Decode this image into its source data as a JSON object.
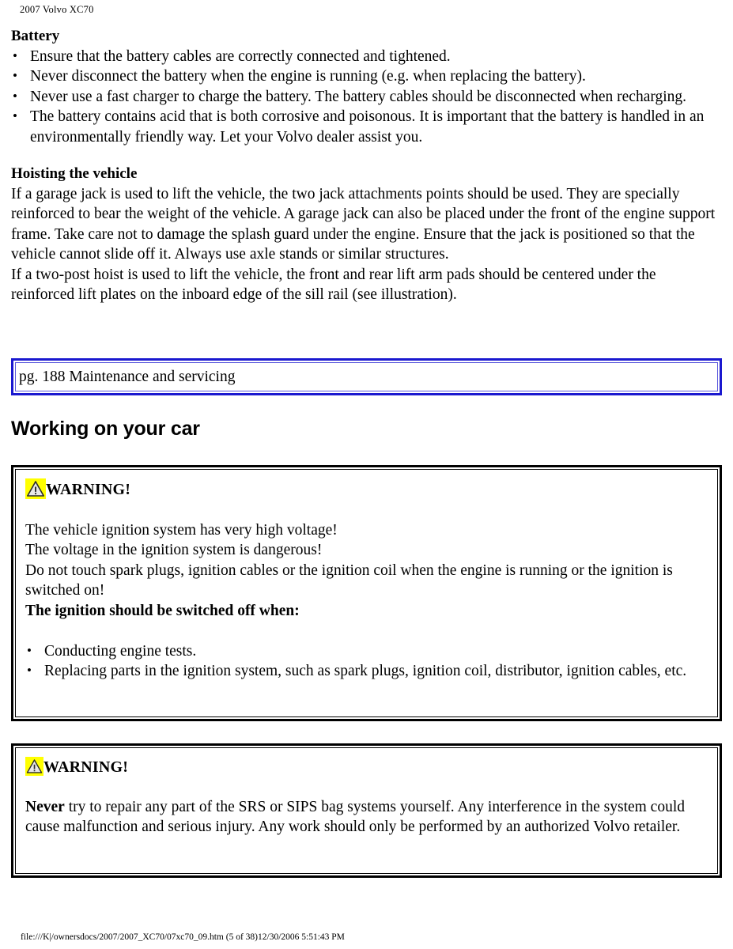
{
  "header": {
    "running_title": "2007 Volvo XC70"
  },
  "sections": {
    "battery": {
      "title": "Battery",
      "bullets": [
        "Ensure that the battery cables are correctly connected and tightened.",
        "Never disconnect the battery when the engine is running (e.g. when replacing the battery).",
        "Never use a fast charger to charge the battery. The battery cables should be disconnected when recharging.",
        "The battery contains acid that is both corrosive and poisonous. It is important that the battery is handled in an environmentally friendly way. Let your Volvo dealer assist you."
      ]
    },
    "hoisting": {
      "title": "Hoisting the vehicle",
      "paragraphs": [
        "If a garage jack is used to lift the vehicle, the two jack attachments points should be used. They are specially reinforced to bear the weight of the vehicle. A garage jack can also be placed under the front of the engine support frame. Take care not to damage the splash guard under the engine. Ensure that the jack is positioned so that the vehicle cannot slide off it. Always use axle stands or similar structures.",
        "If a two-post hoist is used to lift the vehicle, the front and rear lift arm pads should be centered under the reinforced lift plates on the inboard edge of the sill rail (see illustration)."
      ]
    }
  },
  "reference_box": {
    "text": "pg. 188 Maintenance and servicing",
    "border_color": "#1a18cf",
    "inner_border_color": "#5b59dd"
  },
  "chapter_title": "Working on your car",
  "warnings": [
    {
      "icon_name": "warning-triangle-icon",
      "icon_background": "#ffff00",
      "label": "WARNING!",
      "lines": [
        "The vehicle ignition system has very high voltage!",
        "The voltage in the ignition system is dangerous!",
        "Do not touch spark plugs, ignition cables or the ignition coil when the engine is running or the ignition is switched on!"
      ],
      "emphasis_line": "The ignition should be switched off when:",
      "bullets": [
        "Conducting engine tests.",
        "Replacing parts in the ignition system, such as spark plugs, ignition coil, distributor, ignition cables, etc."
      ]
    },
    {
      "icon_name": "warning-triangle-icon",
      "icon_background": "#ffff00",
      "label": "WARNING!",
      "lead_word": "Never",
      "body": " try to repair any part of the SRS or SIPS bag systems yourself. Any interference in the system could cause malfunction and serious injury. Any work should only be performed by an authorized Volvo retailer."
    }
  ],
  "footer": {
    "text": "file:///K|/ownersdocs/2007/2007_XC70/07xc70_09.htm (5 of 38)12/30/2006 5:51:43 PM"
  }
}
